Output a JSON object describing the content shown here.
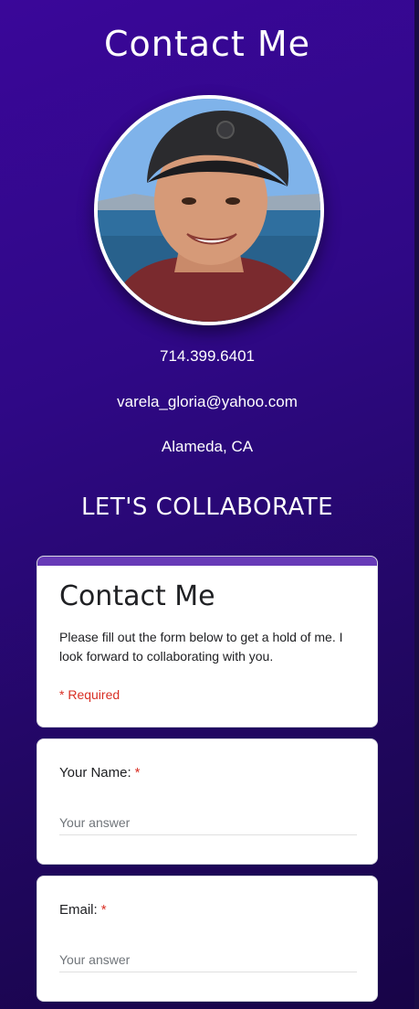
{
  "header": {
    "title": "Contact Me"
  },
  "contact": {
    "phone": "714.399.6401",
    "email": "varela_gloria@yahoo.com",
    "location": "Alameda, CA"
  },
  "section": {
    "heading": "LET'S COLLABORATE"
  },
  "form": {
    "title": "Contact Me",
    "description": "Please fill out the form below to get a hold of me. I look forward to collaborating with you.",
    "required_note": "* Required",
    "accent_color": "#673ab7",
    "questions": [
      {
        "label": "Your Name:",
        "required_mark": "*",
        "placeholder": "Your answer"
      },
      {
        "label": "Email:",
        "required_mark": "*",
        "placeholder": "Your answer"
      }
    ]
  }
}
